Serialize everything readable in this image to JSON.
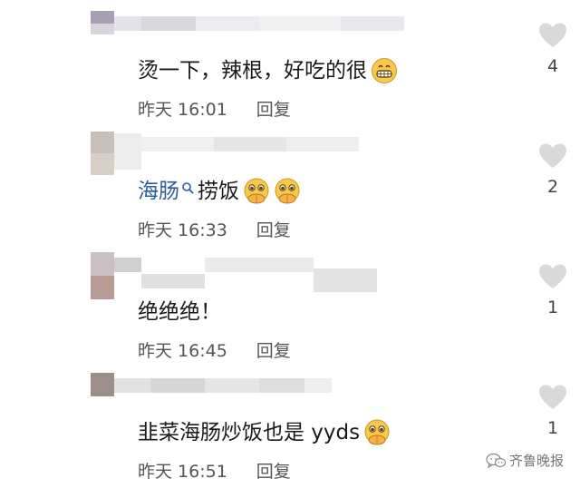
{
  "comments": [
    {
      "text": "烫一下，辣根，好吃的很",
      "time": "昨天 16:01",
      "reply": "回复",
      "likes": "4",
      "emojis": [
        "grin"
      ]
    },
    {
      "tag": "海肠",
      "text": "捞饭",
      "time": "昨天 16:33",
      "reply": "回复",
      "likes": "2",
      "emojis": [
        "pleading-hands",
        "pleading-hands"
      ]
    },
    {
      "text": "绝绝绝！",
      "time": "昨天 16:45",
      "reply": "回复",
      "likes": "1",
      "emojis": []
    },
    {
      "text": "韭菜海肠炒饭也是 yyds",
      "time": "昨天 16:51",
      "reply": "回复",
      "likes": "1",
      "emojis": [
        "pleading-hands"
      ]
    }
  ],
  "watermark": "齐鲁晚报",
  "colors": {
    "tag": "#2e5d9e",
    "meta": "#555555",
    "heart": "#d9d9d9"
  },
  "icons": [
    "heart-icon",
    "search-icon",
    "wechat-icon",
    "grin-emoji",
    "pleading-hands-emoji"
  ]
}
